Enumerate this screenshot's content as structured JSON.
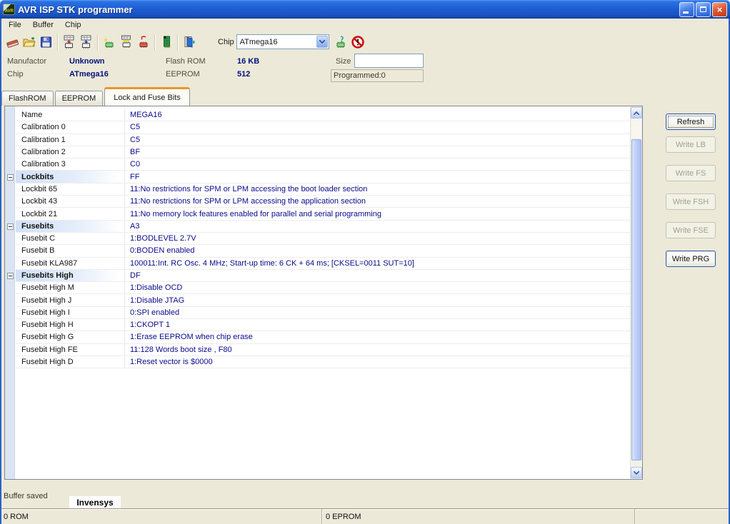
{
  "window": {
    "title": "AVR ISP STK programmer",
    "icon_text": "AVR"
  },
  "menu": {
    "items": [
      {
        "label": "File"
      },
      {
        "label": "Buffer"
      },
      {
        "label": "Chip"
      }
    ]
  },
  "toolbar": {
    "chip_label": "Chip",
    "chip_select_value": "ATmega16",
    "icons": [
      "erase-buffer",
      "open-file",
      "save-file",
      "read-flash-buffer",
      "write-flash-buffer",
      "verify-chip",
      "program-buffer-chip",
      "erase-chip",
      "memory-module",
      "exit",
      "detect-chip",
      "cancel-operation"
    ]
  },
  "info": {
    "manufactor_label": "Manufactor",
    "manufactor_value": "Unknown",
    "chip_label": "Chip",
    "chip_value": "ATmega16",
    "flash_label": "Flash ROM",
    "flash_value": "16 KB",
    "eeprom_label": "EEPROM",
    "eeprom_value": "512",
    "size_label": "Size",
    "size_value": "",
    "programmed_label": "Programmed:0"
  },
  "tabs": [
    {
      "label": "FlashROM",
      "active": false
    },
    {
      "label": "EEPROM",
      "active": false
    },
    {
      "label": "Lock and Fuse Bits",
      "active": true
    }
  ],
  "fuse_table": {
    "rows": [
      {
        "name": "Name",
        "value": "MEGA16",
        "group": false
      },
      {
        "name": "Calibration 0",
        "value": "C5",
        "group": false
      },
      {
        "name": "Calibration 1",
        "value": "C5",
        "group": false
      },
      {
        "name": "Calibration 2",
        "value": "BF",
        "group": false
      },
      {
        "name": "Calibration 3",
        "value": "C0",
        "group": false
      },
      {
        "name": "Lockbits",
        "value": "FF",
        "group": true
      },
      {
        "name": "Lockbit 65",
        "value": "11:No restrictions for SPM or LPM accessing the boot loader section",
        "group": false
      },
      {
        "name": "Lockbit 43",
        "value": "11:No restrictions for SPM or LPM accessing the application section",
        "group": false
      },
      {
        "name": "Lockbit 21",
        "value": "11:No memory lock features enabled for parallel and serial programming",
        "group": false
      },
      {
        "name": "Fusebits",
        "value": "A3",
        "group": true
      },
      {
        "name": "Fusebit C",
        "value": "1:BODLEVEL 2.7V",
        "group": false
      },
      {
        "name": "Fusebit B",
        "value": "0:BODEN enabled",
        "group": false
      },
      {
        "name": "Fusebit KLA987",
        "value": "100011:Int. RC Osc. 4 MHz; Start-up time: 6 CK + 64 ms; [CKSEL=0011 SUT=10]",
        "group": false
      },
      {
        "name": "Fusebits High",
        "value": "DF",
        "group": true
      },
      {
        "name": "Fusebit High M",
        "value": "1:Disable OCD",
        "group": false
      },
      {
        "name": "Fusebit High J",
        "value": "1:Disable JTAG",
        "group": false
      },
      {
        "name": "Fusebit High I",
        "value": "0:SPI enabled",
        "group": false
      },
      {
        "name": "Fusebit High H",
        "value": "1:CKOPT 1",
        "group": false
      },
      {
        "name": "Fusebit High G",
        "value": "1:Erase EEPROM when chip erase",
        "group": false
      },
      {
        "name": "Fusebit High FE",
        "value": "11:128 Words boot size , F80",
        "group": false
      },
      {
        "name": "Fusebit High D",
        "value": "1:Reset vector is $0000",
        "group": false
      }
    ]
  },
  "action_buttons": [
    {
      "label": "Refresh",
      "enabled": true,
      "focused": true
    },
    {
      "label": "Write LB",
      "enabled": false
    },
    {
      "label": "Write FS",
      "enabled": false
    },
    {
      "label": "Write FSH",
      "enabled": false
    },
    {
      "label": "Write FSE",
      "enabled": false
    },
    {
      "label": "Write PRG",
      "enabled": true
    }
  ],
  "footer": {
    "status_text": "Buffer saved",
    "watermark": "Invensys"
  },
  "statusbar": {
    "panes": [
      {
        "label": "0 ROM"
      },
      {
        "label": "0 EPROM"
      },
      {
        "label": ""
      }
    ]
  },
  "colors": {
    "titlebar_blue": "#1e5fd4",
    "face": "#ece9d8",
    "tab_accent_orange": "#e8962e",
    "value_text_navy": "#0a0a8c",
    "group_band_blue": "#d2e1f7",
    "disabled_text": "#a3a08a"
  }
}
